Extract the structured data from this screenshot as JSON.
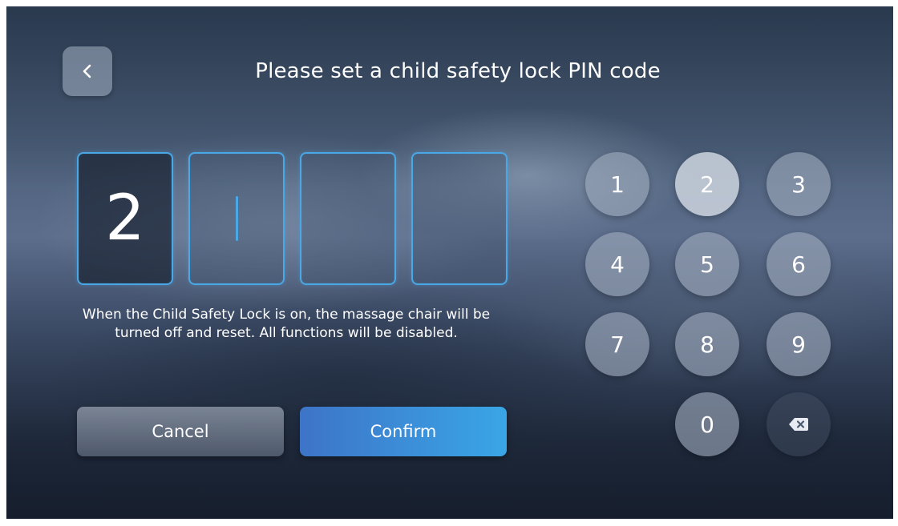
{
  "header": {
    "title": "Please set a child safety lock PIN code",
    "back_icon": "chevron-left-icon"
  },
  "pin": {
    "digits": [
      "2",
      "",
      "",
      ""
    ],
    "active_index": 1,
    "accent_color": "#4aa8e6"
  },
  "notice": {
    "text": "When the Child Safety Lock is on, the massage chair will be turned off and reset. All functions will be disabled."
  },
  "actions": {
    "cancel_label": "Cancel",
    "confirm_label": "Confirm",
    "confirm_color": "#3a8fd8"
  },
  "keypad": {
    "keys": [
      "1",
      "2",
      "3",
      "4",
      "5",
      "6",
      "7",
      "8",
      "9",
      "0"
    ],
    "pressed_key": "2",
    "backspace_icon": "backspace-icon"
  }
}
